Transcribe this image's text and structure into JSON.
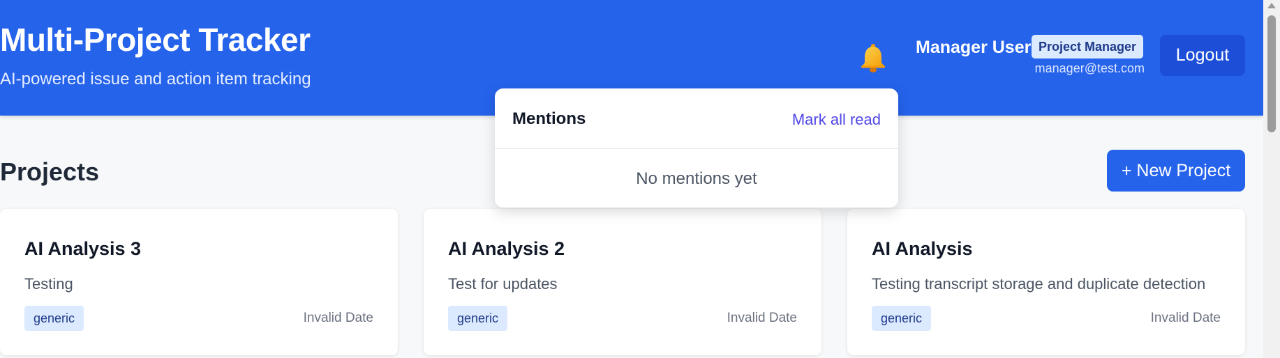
{
  "header": {
    "title": "Multi-Project Tracker",
    "subtitle": "AI-powered issue and action item tracking",
    "notification_icon": "bell-icon",
    "user_name": "Manager User",
    "role": "Project Manager",
    "email": "manager@test.com",
    "logout_label": "Logout",
    "colors": {
      "header_bg": "#2563eb",
      "logout_bg": "#1d4ed8",
      "bell": "#f59e0b"
    }
  },
  "projects_section": {
    "title": "Projects",
    "new_project_label": "+ New Project"
  },
  "projects": [
    {
      "name": "AI Analysis 3",
      "description": "Testing",
      "tag": "generic",
      "date": "Invalid Date"
    },
    {
      "name": "AI Analysis 2",
      "description": "Test for updates",
      "tag": "generic",
      "date": "Invalid Date"
    },
    {
      "name": "AI Analysis",
      "description": "Testing transcript storage and duplicate detection",
      "tag": "generic",
      "date": "Invalid Date"
    }
  ],
  "mentions_dropdown": {
    "title": "Mentions",
    "mark_all_label": "Mark all read",
    "empty_text": "No mentions yet"
  }
}
